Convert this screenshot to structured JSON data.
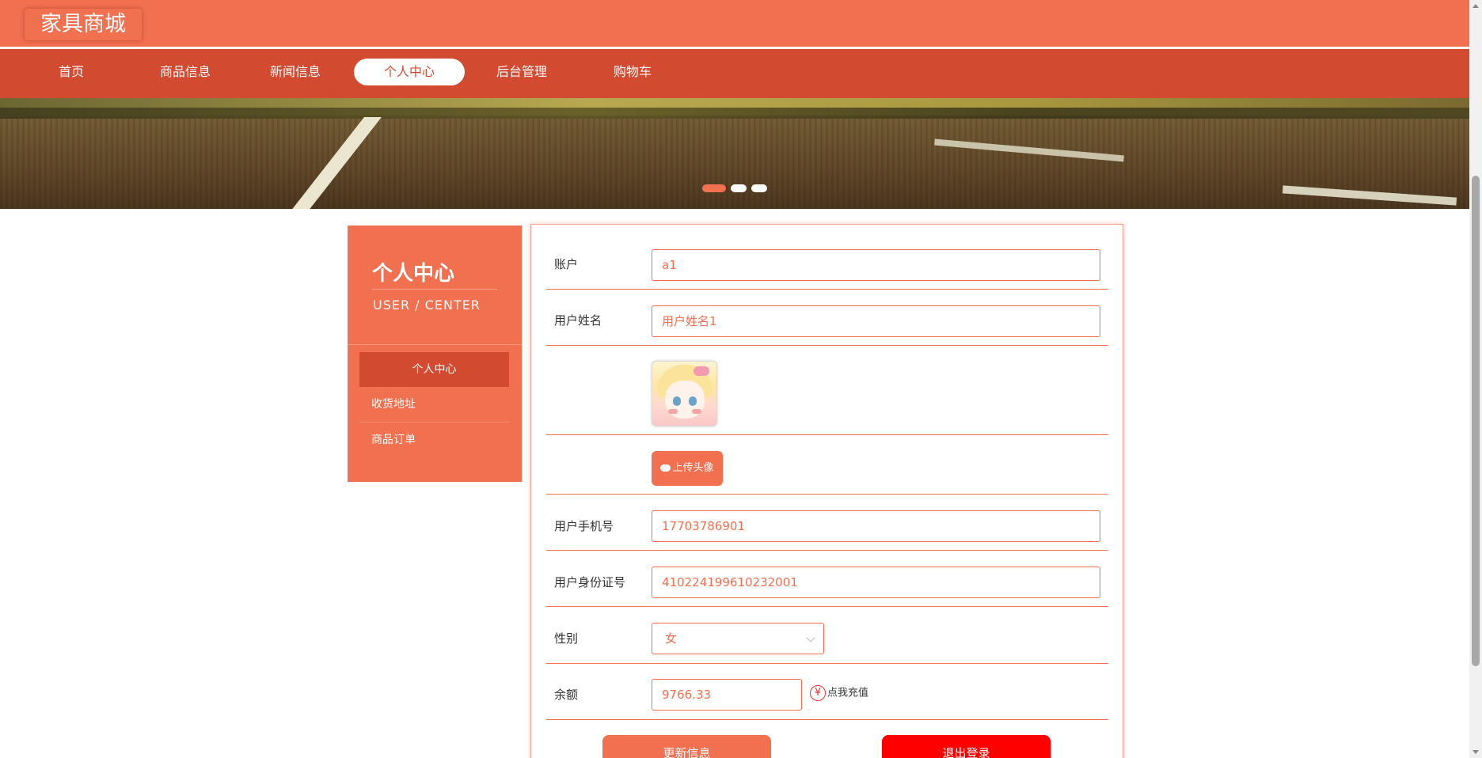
{
  "header": {
    "logo": "家具商城"
  },
  "nav": {
    "items": [
      {
        "label": "首页"
      },
      {
        "label": "商品信息"
      },
      {
        "label": "新闻信息"
      },
      {
        "label": "个人中心"
      },
      {
        "label": "后台管理"
      },
      {
        "label": "购物车"
      }
    ],
    "active": "个人中心"
  },
  "banner": {
    "slide_count": 3,
    "active_slide": 1
  },
  "sidebar": {
    "title": "个人中心",
    "subtitle": "USER / CENTER",
    "items": [
      {
        "label": "个人中心"
      },
      {
        "label": "收货地址"
      },
      {
        "label": "商品订单"
      }
    ]
  },
  "form": {
    "account_label": "账户",
    "account_value": "a1",
    "name_label": "用户姓名",
    "name_value": "用户姓名1",
    "upload_label": "上传头像",
    "phone_label": "用户手机号",
    "phone_value": "17703786901",
    "idcard_label": "用户身份证号",
    "idcard_value": "410224199610232001",
    "gender_label": "性别",
    "gender_value": "女",
    "balance_label": "余额",
    "balance_value": "9766.33",
    "recharge_symbol": "¥",
    "recharge_label": "点我充值",
    "update_button": "更新信息",
    "logout_button": "退出登录"
  },
  "colors": {
    "primary": "#f07050",
    "nav": "#d24a30",
    "danger": "#ff0000"
  }
}
